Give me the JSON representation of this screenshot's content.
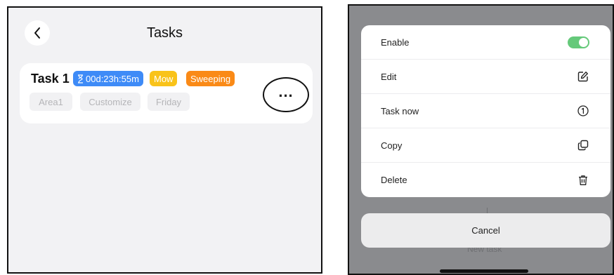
{
  "left": {
    "title": "Tasks",
    "task": {
      "name": "Task 1",
      "timer": "00d:23h:55m",
      "badges": [
        "Mow",
        "Sweeping"
      ],
      "tags": [
        "Area1",
        "Customize",
        "Friday"
      ]
    }
  },
  "right": {
    "menu": [
      {
        "label": "Enable",
        "icon": "toggle-on"
      },
      {
        "label": "Edit",
        "icon": "edit-icon"
      },
      {
        "label": "Task now",
        "icon": "number-one-icon"
      },
      {
        "label": "Copy",
        "icon": "copy-icon"
      },
      {
        "label": "Delete",
        "icon": "trash-icon"
      }
    ],
    "enable_on": true,
    "cancel_label": "Cancel",
    "behind_text": "New task"
  },
  "colors": {
    "timer": "#3e8bf7",
    "mow": "#f9c31a",
    "sweeping": "#fa8a17",
    "toggle": "#65c97a"
  }
}
